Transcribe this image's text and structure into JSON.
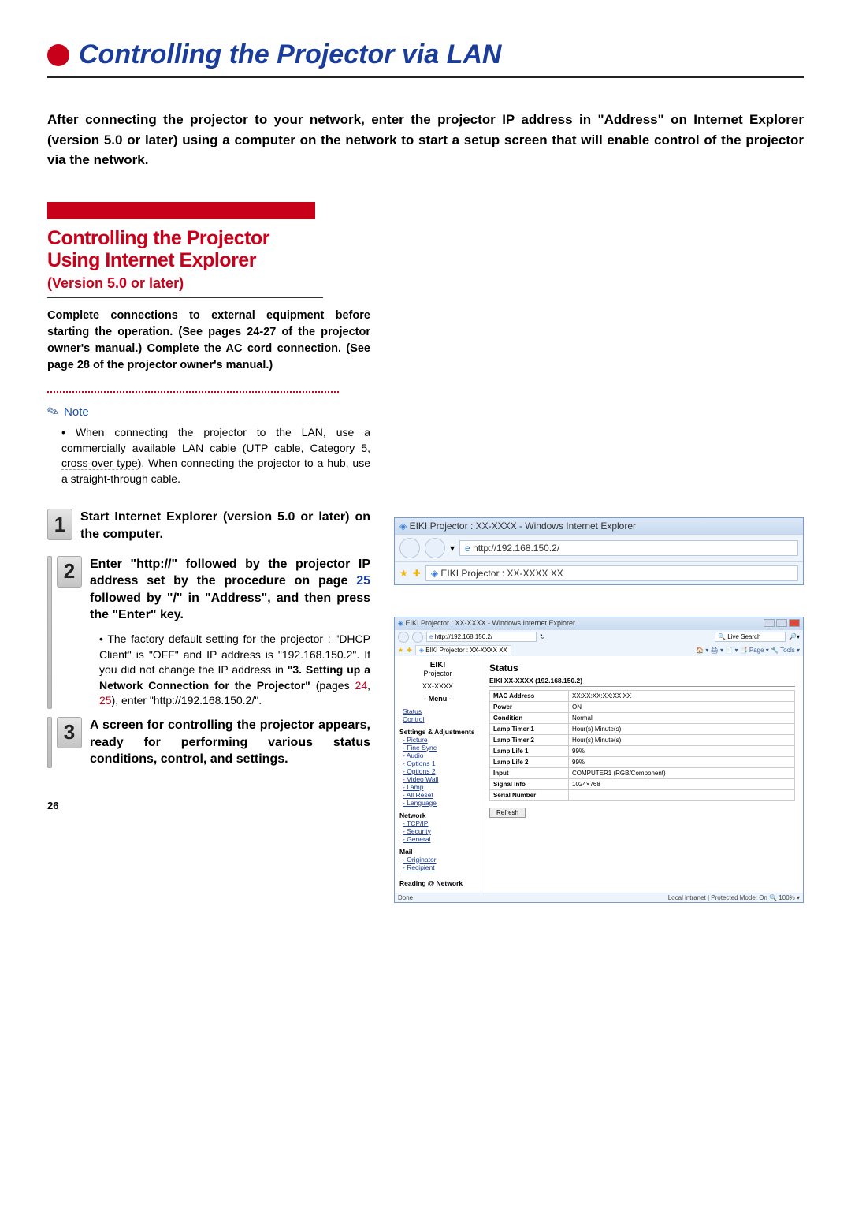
{
  "page": {
    "title": "Controlling the Projector via LAN",
    "number": "26"
  },
  "intro": "After connecting the projector to your network, enter the projector IP address in \"Address\" on Internet Explorer (version 5.0 or later) using a computer on the network to start a setup screen that will enable control of the projector via the network.",
  "section": {
    "heading1": "Controlling the Projector",
    "heading2": "Using Internet Explorer",
    "version": "(Version 5.0 or later)",
    "para": "Complete connections to external equipment before starting the operation. (See pages 24-27 of the projector owner's manual.) Complete the AC cord connection. (See page 28 of the projector owner's manual.)"
  },
  "note": {
    "label": "Note",
    "body_pre": "When connecting the projector to the LAN, use a commercially available LAN cable (UTP cable, Category 5, ",
    "body_dash": "cross-over type",
    "body_post": "). When connecting the projector to a hub, use a straight-through cable."
  },
  "steps": {
    "s1": {
      "num": "1",
      "title": "Start Internet Explorer (version 5.0 or later) on the computer."
    },
    "s2": {
      "num": "2",
      "title_a": "Enter \"http://\" followed by the projector IP address set by the procedure on page ",
      "page_a": "25",
      "title_b": " followed by \"/\" in \"Address\", and then press the \"Enter\" key.",
      "sub_a": "The factory default setting for the projector : \"DHCP Client\" is \"OFF\" and IP address is \"192.168.150.2\". If you did not change the IP address in ",
      "sub_bold": "\"3. Setting up a Network Connection for the Projector\"",
      "sub_b": " (pages ",
      "pg1": "24",
      "comma": ", ",
      "pg2": "25",
      "sub_c": "), enter \"http://192.168.150.2/\"."
    },
    "s3": {
      "num": "3",
      "title": "A screen for controlling the projector appears, ready for performing various status conditions, control, and settings."
    }
  },
  "ie": {
    "window_title": "EIKI Projector : XX-XXXX - Windows Internet Explorer",
    "url": "http://192.168.150.2/",
    "tab_title": "EIKI Projector : XX-XXXX XX",
    "search_placeholder": "Live Search",
    "tools": "🏠 ▾  🖨 ▾  📄 ▾  📑 Page ▾  🔧 Tools ▾",
    "sidebar": {
      "brand": "EIKI",
      "proj": "Projector",
      "model": "XX-XXXX",
      "menu": "- Menu -",
      "status": "Status",
      "control": "Control",
      "settings": "Settings & Adjustments",
      "items": [
        "- Picture",
        "- Fine Sync",
        "- Audio",
        "- Options 1",
        "- Options 2",
        "- Video Wall",
        "- Lamp",
        "- All Reset",
        "- Language"
      ],
      "network": "Network",
      "netitems": [
        "- TCP/IP",
        "- Security",
        "- General"
      ],
      "mail": "Mail",
      "mailitems": [
        "- Originator",
        "- Recipient"
      ],
      "last": "Reading @ Network"
    },
    "main": {
      "heading": "Status",
      "subhead": "EIKI XX-XXXX (192.168.150.2)",
      "rows": [
        [
          "MAC Address",
          "XX:XX:XX:XX:XX:XX"
        ],
        [
          "Power",
          "ON"
        ],
        [
          "Condition",
          "Normal"
        ],
        [
          "Lamp Timer 1",
          "Hour(s) Minute(s)"
        ],
        [
          "Lamp Timer 2",
          "Hour(s) Minute(s)"
        ],
        [
          "Lamp Life 1",
          "99%"
        ],
        [
          "Lamp Life 2",
          "99%"
        ],
        [
          "Input",
          "COMPUTER1 (RGB/Component)"
        ],
        [
          "Signal Info",
          "1024×768"
        ],
        [
          "Serial Number",
          ""
        ]
      ],
      "refresh": "Refresh"
    },
    "statusbar": {
      "left": "Done",
      "right": "Local intranet | Protected Mode: On     🔍 100%  ▾"
    }
  }
}
